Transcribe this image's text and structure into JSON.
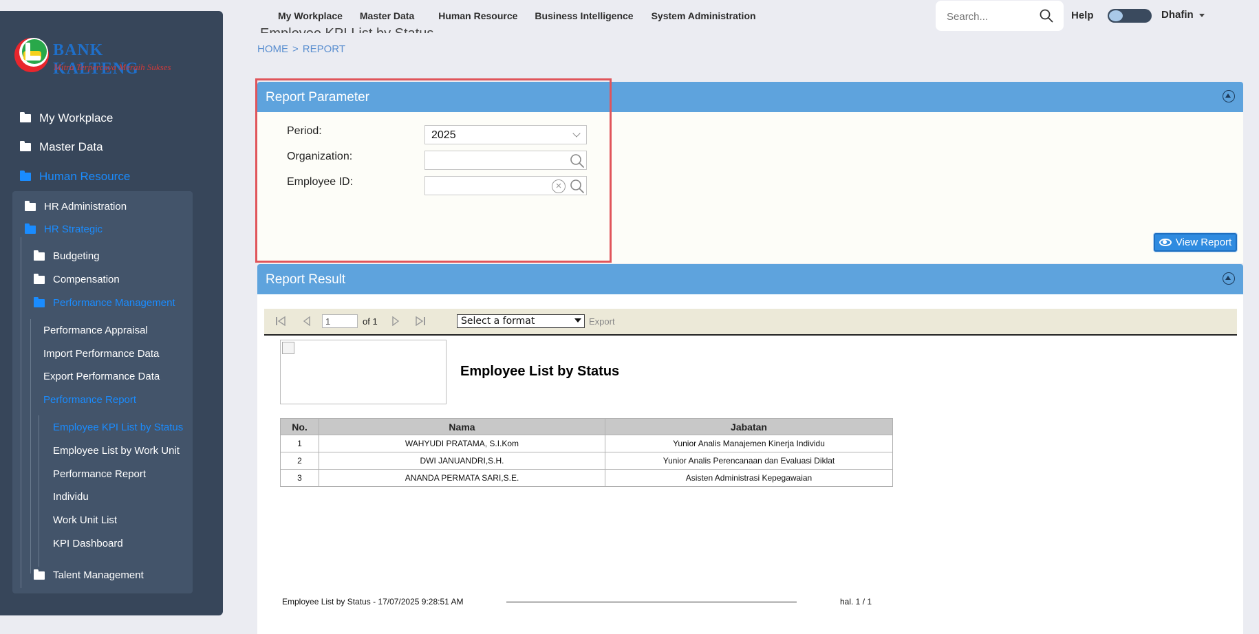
{
  "topnav": {
    "items": [
      "My Workplace",
      "Master Data",
      "Human Resource",
      "Business Intelligence",
      "System Administration"
    ],
    "search_placeholder": "Search...",
    "help": "Help",
    "user": "Dhafin"
  },
  "page_title_fragment": "Employee KPI List by Status",
  "breadcrumb": {
    "home": "HOME",
    "separator": ">",
    "current": "REPORT"
  },
  "sidebar": {
    "logo": {
      "brand": "BANK KALTENG",
      "slogan": "Mitra Terpercaya Meraih Sukses"
    },
    "items": [
      {
        "label": "My Workplace"
      },
      {
        "label": "Master Data"
      },
      {
        "label": "Human Resource"
      },
      {
        "label": "HR Administration"
      },
      {
        "label": "HR Strategic"
      },
      {
        "label": "Budgeting"
      },
      {
        "label": "Compensation"
      },
      {
        "label": "Performance Management"
      },
      {
        "label": "Performance Appraisal"
      },
      {
        "label": "Import Performance Data"
      },
      {
        "label": "Export Performance Data"
      },
      {
        "label": "Performance Report"
      },
      {
        "label": "Employee KPI List by Status"
      },
      {
        "label": "Employee List by Work Unit"
      },
      {
        "label": "Performance Report"
      },
      {
        "label": "Individu"
      },
      {
        "label": "Work Unit List"
      },
      {
        "label": "KPI Dashboard"
      },
      {
        "label": "Talent Management"
      }
    ],
    "colors": {
      "background": "#37465a",
      "active": "#1a8cff"
    }
  },
  "report_parameter": {
    "title": "Report Parameter",
    "fields": {
      "period": {
        "label": "Period:",
        "value": "2025"
      },
      "organization": {
        "label": "Organization:",
        "value": ""
      },
      "employee_id": {
        "label": "Employee ID:",
        "value": ""
      }
    },
    "view_report_button": "View Report"
  },
  "report_result": {
    "title": "Report Result",
    "toolbar": {
      "page_value": "1",
      "of_text": "of 1",
      "format_select": "Select a format",
      "export": "Export"
    },
    "report_title": "Employee List by Status",
    "table": {
      "columns": [
        "No.",
        "Nama",
        "Jabatan"
      ],
      "rows": [
        [
          "1",
          "WAHYUDI PRATAMA, S.I.Kom",
          "Yunior Analis Manajemen Kinerja Individu"
        ],
        [
          "2",
          "DWI JANUANDRI,S.H.",
          "Yunior Analis Perencanaan dan  Evaluasi Diklat"
        ],
        [
          "3",
          "ANANDA PERMATA SARI,S.E.",
          "Asisten Administrasi Kepegawaian"
        ]
      ]
    },
    "footer": {
      "left": "Employee List by Status - 17/07/2025 9:28:51 AM",
      "right": "hal. 1 / 1"
    }
  },
  "colors": {
    "page_bg": "#ebecf2",
    "panel_header": "#5ea3dd",
    "highlight_border": "#e0555b",
    "button": "#2f8be0"
  }
}
